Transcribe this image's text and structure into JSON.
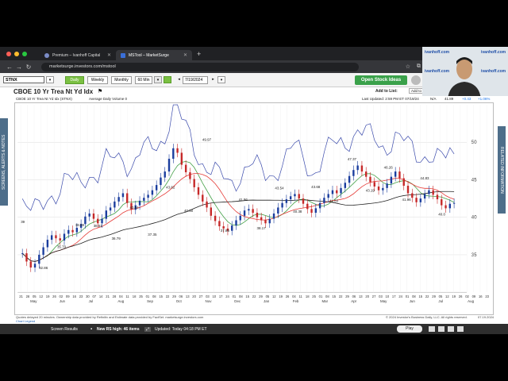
{
  "browser": {
    "tabs": [
      {
        "label": "Premium – Ivanhoff Capital",
        "active": false
      },
      {
        "label": "MSTool – MarketSurge",
        "active": true
      }
    ],
    "url": "marketsurge.investors.com/mstool"
  },
  "toolbar": {
    "symbol": "STNX",
    "periods": [
      "Daily",
      "Weekly",
      "Monthly",
      "60 Min"
    ],
    "active_period": "Daily",
    "date": "7/19/2024",
    "open_stock_ideas": "Open Stock Ideas"
  },
  "chart_header": {
    "title": "CBOE 10 Yr Trea Nt Yd Idx",
    "add_to_list": "Add to List:",
    "add_to_new_list": "Add to New List",
    "info_left": "CBOE 10 Yr Trea Nt Yd Idx  (STNX)",
    "info_avg": "Average Daily Volume 0",
    "last_updated": "Last Updated: 2:59 PM ET 07/19/24",
    "price_info": "41.89",
    "change_info": "+0.43",
    "pct_info": "+1.06%",
    "na": "N/A",
    "index_scale": "Index Scale"
  },
  "sidebars": {
    "left": "SCREENS, ALERTS & NOTES",
    "right": "RELATED INFORMATION"
  },
  "footer": {
    "note": "Quotes delayed 20 minutes. Ownership data provided by Refinitiv and Estimate data provided by FactSet. marketsurge.investors.com",
    "copyright": "© 2024 Investor's Business Daily, LLC. All rights reserved.",
    "date": "07.19.2024",
    "legend": "Chart Legend"
  },
  "statusbar": {
    "screen_results": "Screen Results",
    "rs_high": "New RS high: 46 items",
    "updated": "Updated: Today 04:18 PM ET",
    "play": "Play"
  },
  "webcam": {
    "label": "ivanhoff.com"
  },
  "chart_data": {
    "type": "candlestick",
    "title": "CBOE 10 Yr Trea Nt Yd Idx",
    "ylim": [
      30,
      55
    ],
    "y_ticks": [
      35,
      40,
      45,
      50
    ],
    "x_ticks": [
      "21",
      "28",
      "05",
      "12",
      "19",
      "26",
      "02",
      "09",
      "16",
      "23",
      "30",
      "07",
      "14",
      "21",
      "28",
      "04",
      "11",
      "18",
      "25",
      "01",
      "08",
      "15",
      "22",
      "29",
      "06",
      "13",
      "20",
      "27",
      "03",
      "10",
      "17",
      "24",
      "01",
      "08",
      "15",
      "22",
      "29",
      "05",
      "12",
      "19",
      "26",
      "04",
      "11",
      "18",
      "25",
      "01",
      "08",
      "15",
      "22",
      "29",
      "06",
      "13",
      "20",
      "27",
      "03",
      "10",
      "17",
      "24",
      "01",
      "08",
      "15",
      "22",
      "29",
      "05",
      "12",
      "19",
      "26",
      "02",
      "09",
      "16",
      "23"
    ],
    "months": [
      "May",
      "Jun",
      "Jul",
      "Aug",
      "Sep",
      "Oct",
      "Nov",
      "Dec",
      "Jan",
      "Feb",
      "Mar",
      "Apr",
      "May",
      "Jun",
      "Jul",
      "Aug"
    ],
    "price_labels": [
      {
        "value": "39",
        "y": 39.0
      },
      {
        "value": "32.86",
        "y": 32.86
      },
      {
        "value": "35.70",
        "y": 35.7
      },
      {
        "value": "38.59",
        "y": 38.59
      },
      {
        "value": "38.51",
        "y": 38.51
      },
      {
        "value": "36.79",
        "y": 36.79
      },
      {
        "value": "40.94",
        "y": 40.94
      },
      {
        "value": "37.35",
        "y": 37.35
      },
      {
        "value": "43.62",
        "y": 43.62
      },
      {
        "value": "40.50",
        "y": 40.5
      },
      {
        "value": "49.97",
        "y": 49.97
      },
      {
        "value": "37.85",
        "y": 37.85
      },
      {
        "value": "41.96",
        "y": 41.96
      },
      {
        "value": "38.17",
        "y": 38.17
      },
      {
        "value": "43.54",
        "y": 43.54
      },
      {
        "value": "40.38",
        "y": 40.38
      },
      {
        "value": "43.68",
        "y": 43.68
      },
      {
        "value": "41.83",
        "y": 41.83
      },
      {
        "value": "47.37",
        "y": 47.37
      },
      {
        "value": "43.19",
        "y": 43.19
      },
      {
        "value": "46.26",
        "y": 46.26
      },
      {
        "value": "41.96",
        "y": 41.96
      },
      {
        "value": "44.83",
        "y": 44.83
      },
      {
        "value": "40.0",
        "y": 40.0
      }
    ],
    "close_series": [
      35.2,
      34.1,
      33.3,
      33.8,
      35.0,
      36.0,
      37.0,
      37.6,
      37.2,
      36.9,
      37.8,
      38.3,
      38.0,
      38.6,
      39.1,
      40.1,
      40.5,
      39.8,
      39.2,
      39.8,
      40.9,
      41.3,
      42.1,
      42.7,
      43.2,
      41.9,
      41.0,
      41.6,
      42.2,
      42.6,
      43.0,
      43.6,
      44.3,
      45.3,
      46.1,
      47.8,
      49.2,
      48.6,
      47.0,
      46.0,
      45.1,
      44.0,
      43.0,
      42.1,
      41.3,
      40.2,
      39.5,
      38.8,
      38.5,
      38.2,
      38.9,
      39.6,
      40.2,
      40.9,
      41.1,
      40.6,
      40.0,
      39.6,
      39.2,
      39.8,
      40.5,
      41.3,
      41.9,
      42.4,
      42.8,
      43.1,
      42.5,
      41.8,
      41.1,
      40.6,
      41.2,
      41.9,
      42.6,
      43.1,
      43.6,
      43.2,
      43.9,
      44.6,
      45.5,
      46.3,
      46.9,
      46.1,
      45.4,
      44.7,
      44.1,
      43.6,
      43.9,
      44.5,
      45.4,
      46.1,
      45.2,
      44.2,
      43.2,
      42.6,
      42.0,
      42.5,
      43.1,
      43.6,
      43.0,
      42.4,
      41.6,
      41.2,
      41.8,
      41.9
    ]
  }
}
